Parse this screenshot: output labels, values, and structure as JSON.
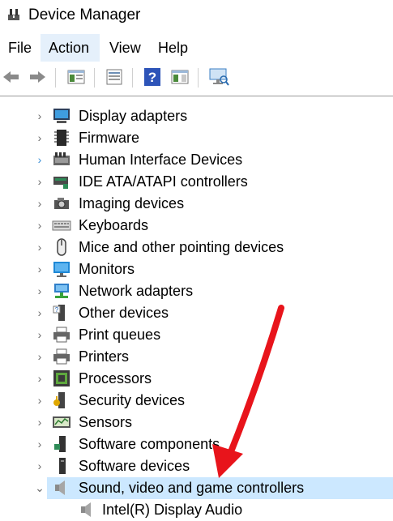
{
  "window": {
    "title": "Device Manager",
    "app_icon": "device-manager-icon"
  },
  "menu": [
    {
      "label": "File",
      "active": false
    },
    {
      "label": "Action",
      "active": true
    },
    {
      "label": "View",
      "active": false
    },
    {
      "label": "Help",
      "active": false
    }
  ],
  "toolbar": [
    {
      "name": "back-icon"
    },
    {
      "name": "forward-icon"
    },
    {
      "name": "show-hide-console-tree-icon"
    },
    {
      "name": "properties-icon"
    },
    {
      "name": "help-icon"
    },
    {
      "name": "action-pane-icon"
    },
    {
      "name": "monitor-scan-icon"
    }
  ],
  "tree": [
    {
      "label": "Display adapters",
      "icon": "display-adapter-icon",
      "expanded": false
    },
    {
      "label": "Firmware",
      "icon": "firmware-icon",
      "expanded": false
    },
    {
      "label": "Human Interface Devices",
      "icon": "hid-icon",
      "expanded": false,
      "chevron_color": "#3a8fd6"
    },
    {
      "label": "IDE ATA/ATAPI controllers",
      "icon": "ide-controller-icon",
      "expanded": false
    },
    {
      "label": "Imaging devices",
      "icon": "camera-icon",
      "expanded": false
    },
    {
      "label": "Keyboards",
      "icon": "keyboard-icon",
      "expanded": false
    },
    {
      "label": "Mice and other pointing devices",
      "icon": "mouse-icon",
      "expanded": false
    },
    {
      "label": "Monitors",
      "icon": "monitor-icon",
      "expanded": false
    },
    {
      "label": "Network adapters",
      "icon": "network-adapter-icon",
      "expanded": false
    },
    {
      "label": "Other devices",
      "icon": "other-devices-icon",
      "expanded": false
    },
    {
      "label": "Print queues",
      "icon": "printer-icon",
      "expanded": false
    },
    {
      "label": "Printers",
      "icon": "printer-icon",
      "expanded": false
    },
    {
      "label": "Processors",
      "icon": "processor-icon",
      "expanded": false
    },
    {
      "label": "Security devices",
      "icon": "security-device-icon",
      "expanded": false
    },
    {
      "label": "Sensors",
      "icon": "sensor-icon",
      "expanded": false
    },
    {
      "label": "Software components",
      "icon": "software-component-icon",
      "expanded": false
    },
    {
      "label": "Software devices",
      "icon": "software-device-icon",
      "expanded": false
    },
    {
      "label": "Sound, video and game controllers",
      "icon": "speaker-icon",
      "expanded": true,
      "selected": true
    },
    {
      "label": "Intel(R) Display Audio",
      "icon": "speaker-icon",
      "child": true
    }
  ],
  "colors": {
    "selection": "#cce8ff",
    "menu_active": "#e5f0fb",
    "annotation_arrow": "#e8141b"
  }
}
